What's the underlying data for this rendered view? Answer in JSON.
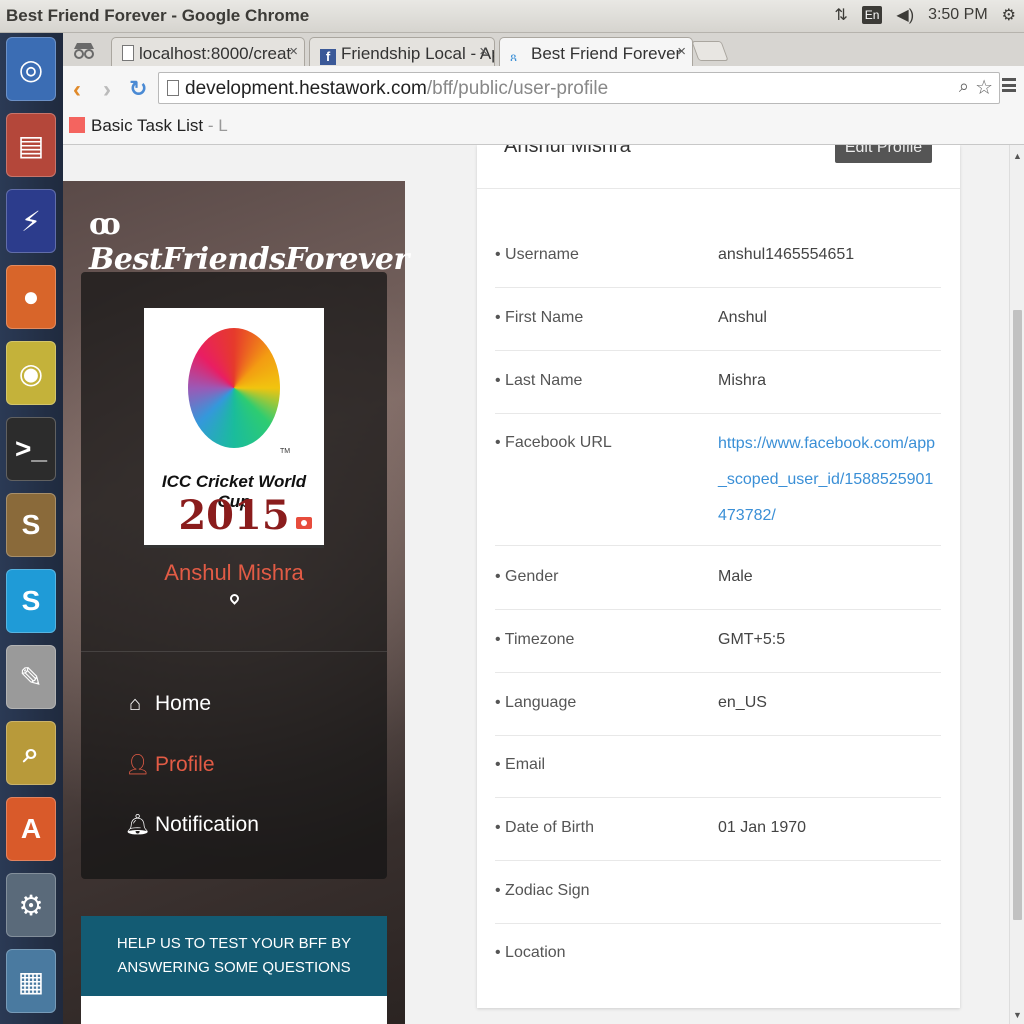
{
  "window": {
    "title": "Best Friend Forever - Google Chrome"
  },
  "system": {
    "keyboard": "En",
    "time": "3:50 PM"
  },
  "tabs": [
    {
      "label": "localhost:8000/creat"
    },
    {
      "label": "Friendship Local - Ap"
    },
    {
      "label": "Best Friend Forever"
    }
  ],
  "address": {
    "host": "development.hestawork.com",
    "path": "/bff/public/user-profile"
  },
  "bookmarks": {
    "item": "Basic Task List",
    "item_rest": " - L"
  },
  "brand": {
    "logo_text": "BestFriendsForever"
  },
  "avatar": {
    "title": "ICC Cricket World Cup",
    "year": "2015",
    "tm": "TM"
  },
  "user": {
    "name": "Anshul Mishra"
  },
  "nav": [
    {
      "label": "Home",
      "icon": "home-icon"
    },
    {
      "label": "Profile",
      "icon": "user-icon"
    },
    {
      "label": "Notification",
      "icon": "bell-icon"
    }
  ],
  "quiz": {
    "heading": "HELP US TO TEST YOUR BFF BY ANSWERING SOME QUESTIONS"
  },
  "profile": {
    "name": "Anshul Mishra",
    "edit_label": "Edit Profile",
    "fields": [
      {
        "label": "• Username",
        "value": "anshul1465554651"
      },
      {
        "label": "• First Name",
        "value": "Anshul"
      },
      {
        "label": "• Last Name",
        "value": "Mishra"
      },
      {
        "label": "• Facebook URL",
        "value": "https://www.facebook.com/app_scoped_user_id/1588525901473782/"
      },
      {
        "label": "• Gender",
        "value": "Male"
      },
      {
        "label": "• Timezone",
        "value": "GMT+5:5"
      },
      {
        "label": "• Language",
        "value": "en_US"
      },
      {
        "label": "• Email",
        "value": ""
      },
      {
        "label": "• Date of Birth",
        "value": "01 Jan 1970"
      },
      {
        "label": "• Zodiac Sign",
        "value": ""
      },
      {
        "label": "• Location",
        "value": ""
      }
    ]
  },
  "colors": {
    "accent": "#e25b45",
    "link": "#3a8fd6",
    "quiz_header": "#135b73"
  }
}
